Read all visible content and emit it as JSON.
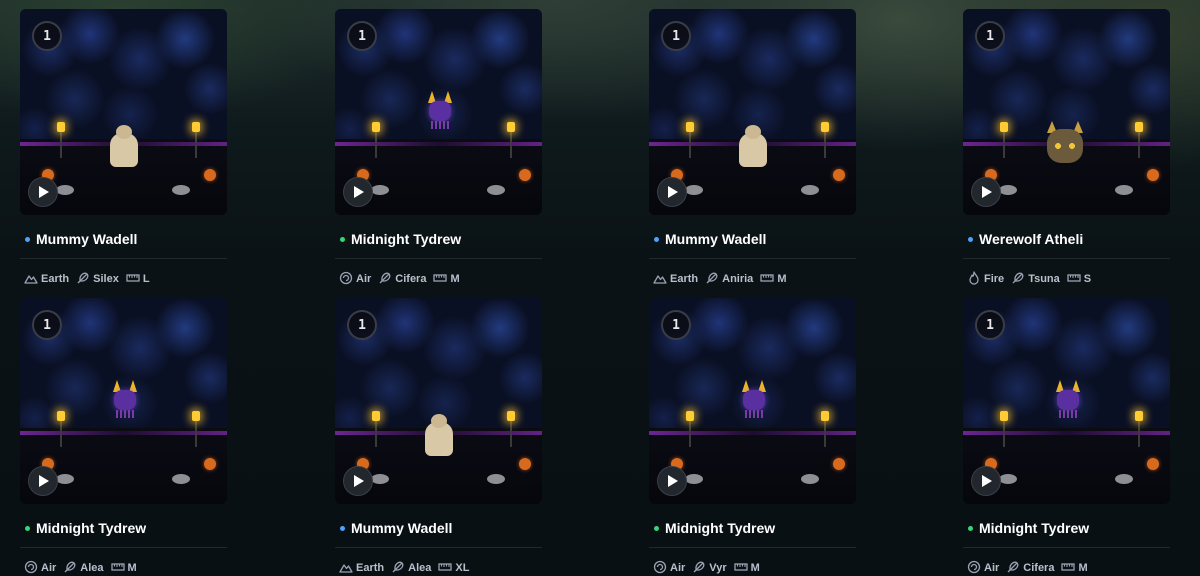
{
  "colors": {
    "dot_blue": "#4aa3ff",
    "dot_green": "#35d67a",
    "attr_text": "#b9c0cc",
    "icon_stroke": "#9aa3b2"
  },
  "cards": [
    {
      "count": "1",
      "name": "Mummy Wadell",
      "dot": "blue",
      "creature": "mummy",
      "element": "Earth",
      "element_icon": "mountain-icon",
      "species": "Silex",
      "species_icon": "feather-icon",
      "size": "L",
      "size_icon": "ruler-icon"
    },
    {
      "count": "1",
      "name": "Midnight Tydrew",
      "dot": "green",
      "creature": "imp",
      "element": "Air",
      "element_icon": "swirl-icon",
      "species": "Cifera",
      "species_icon": "feather-icon",
      "size": "M",
      "size_icon": "ruler-icon"
    },
    {
      "count": "1",
      "name": "Mummy Wadell",
      "dot": "blue",
      "creature": "mummy",
      "element": "Earth",
      "element_icon": "mountain-icon",
      "species": "Aniria",
      "species_icon": "feather-icon",
      "size": "M",
      "size_icon": "ruler-icon"
    },
    {
      "count": "1",
      "name": "Werewolf Atheli",
      "dot": "blue",
      "creature": "werewolf",
      "element": "Fire",
      "element_icon": "flame-icon",
      "species": "Tsuna",
      "species_icon": "feather-icon",
      "size": "S",
      "size_icon": "ruler-icon"
    },
    {
      "count": "1",
      "name": "Midnight Tydrew",
      "dot": "green",
      "creature": "imp",
      "element": "Air",
      "element_icon": "swirl-icon",
      "species": "Alea",
      "species_icon": "feather-icon",
      "size": "M",
      "size_icon": "ruler-icon"
    },
    {
      "count": "1",
      "name": "Mummy Wadell",
      "dot": "blue",
      "creature": "mummy",
      "element": "Earth",
      "element_icon": "mountain-icon",
      "species": "Alea",
      "species_icon": "feather-icon",
      "size": "XL",
      "size_icon": "ruler-icon"
    },
    {
      "count": "1",
      "name": "Midnight Tydrew",
      "dot": "green",
      "creature": "imp",
      "element": "Air",
      "element_icon": "swirl-icon",
      "species": "Vyr",
      "species_icon": "feather-icon",
      "size": "M",
      "size_icon": "ruler-icon"
    },
    {
      "count": "1",
      "name": "Midnight Tydrew",
      "dot": "green",
      "creature": "imp",
      "element": "Air",
      "element_icon": "swirl-icon",
      "species": "Cifera",
      "species_icon": "feather-icon",
      "size": "M",
      "size_icon": "ruler-icon"
    }
  ]
}
